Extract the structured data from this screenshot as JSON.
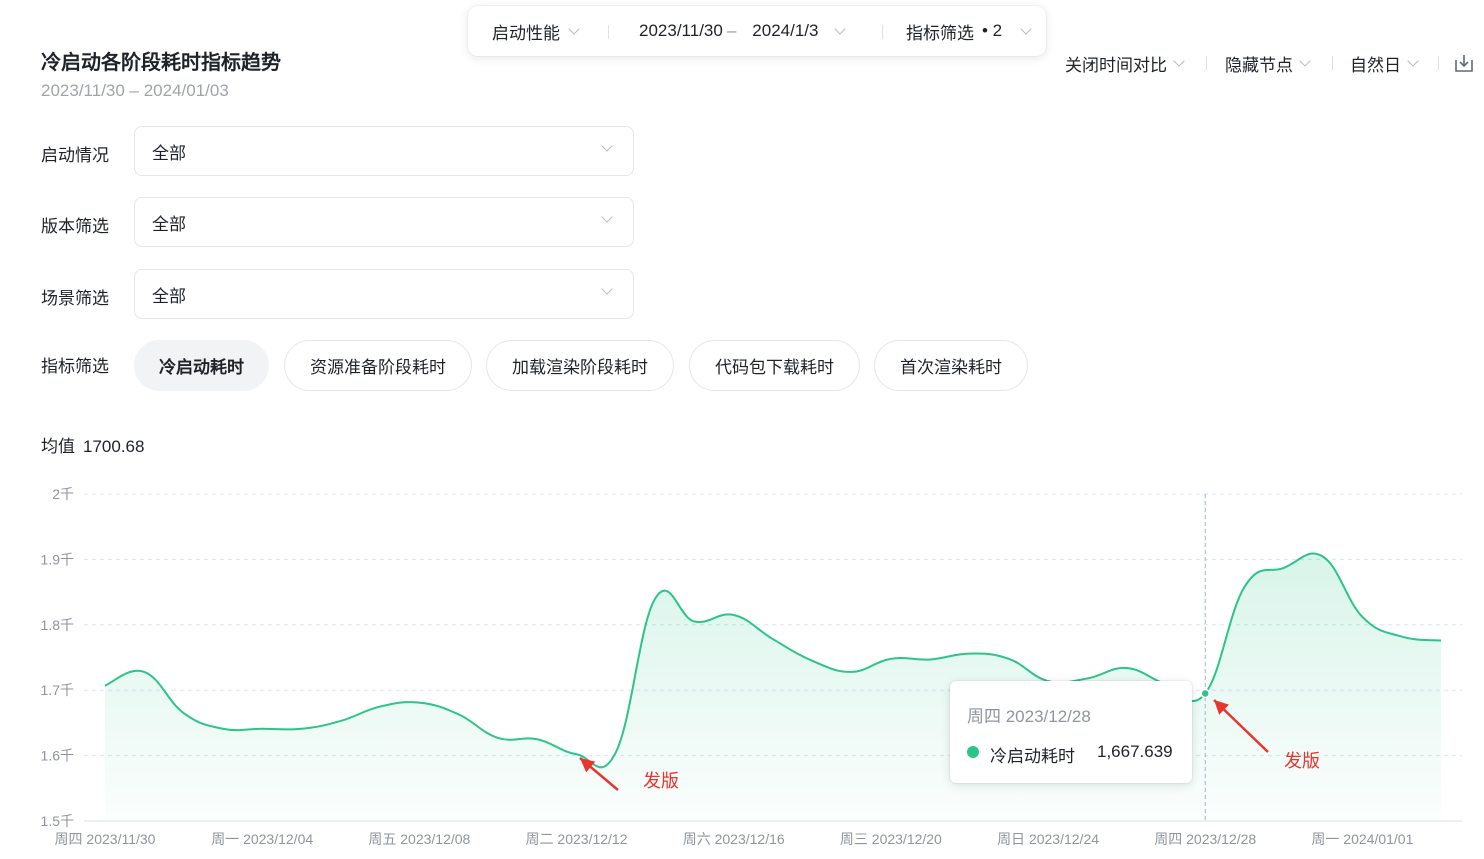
{
  "toolbar": {
    "category": "启动性能",
    "date_start": "2023/11/30",
    "date_sep": "–",
    "date_end": "2024/1/3",
    "metric_filter": "指标筛选",
    "metric_count_prefix": "• 2"
  },
  "card": {
    "title": "冷启动各阶段耗时指标趋势",
    "subtitle": "2023/11/30 – 2024/01/03"
  },
  "controls": {
    "compare": "关闭时间对比",
    "hide_nodes": "隐藏节点",
    "granularity": "自然日"
  },
  "filters": [
    {
      "label": "启动情况",
      "value": "全部"
    },
    {
      "label": "版本筛选",
      "value": "全部"
    },
    {
      "label": "场景筛选",
      "value": "全部"
    }
  ],
  "metric_filter": {
    "label": "指标筛选",
    "chips": [
      "冷启动耗时",
      "资源准备阶段耗时",
      "加载渲染阶段耗时",
      "代码包下载耗时",
      "首次渲染耗时"
    ],
    "active_index": 0
  },
  "average": {
    "label": "均值",
    "value": "1700.68"
  },
  "tooltip": {
    "date": "周四 2023/12/28",
    "series": "冷启动耗时",
    "value": "1,667.639"
  },
  "annotations": [
    "发版",
    "发版"
  ],
  "colors": {
    "series": "#2bc48a",
    "annotation": "#e8352e"
  },
  "chart_data": {
    "type": "area",
    "y_ticks": [
      "1.5千",
      "1.6千",
      "1.7千",
      "1.8千",
      "1.9千",
      "2千"
    ],
    "ylim": [
      1500,
      2000
    ],
    "x_tick_labels": [
      "周四 2023/11/30",
      "周一 2023/12/04",
      "周五 2023/12/08",
      "周二 2023/12/12",
      "周六 2023/12/16",
      "周三 2023/12/20",
      "周日 2023/12/24",
      "周四 2023/12/28",
      "周一 2024/01/01"
    ],
    "x": [
      "2023/11/30",
      "2023/12/01",
      "2023/12/02",
      "2023/12/03",
      "2023/12/04",
      "2023/12/05",
      "2023/12/06",
      "2023/12/07",
      "2023/12/08",
      "2023/12/09",
      "2023/12/10",
      "2023/12/11",
      "2023/12/12",
      "2023/12/13",
      "2023/12/14",
      "2023/12/15",
      "2023/12/16",
      "2023/12/17",
      "2023/12/18",
      "2023/12/19",
      "2023/12/20",
      "2023/12/21",
      "2023/12/22",
      "2023/12/23",
      "2023/12/24",
      "2023/12/25",
      "2023/12/26",
      "2023/12/27",
      "2023/12/28",
      "2023/12/29",
      "2023/12/30",
      "2023/12/31",
      "2024/01/01",
      "2024/01/02",
      "2024/01/03"
    ],
    "series": [
      {
        "name": "冷启动耗时",
        "values": [
          1707,
          1728,
          1665,
          1641,
          1641,
          1641,
          1653,
          1675,
          1681,
          1663,
          1627,
          1625,
          1602,
          1605,
          1840,
          1805,
          1815,
          1778,
          1745,
          1728,
          1748,
          1747,
          1756,
          1748,
          1714,
          1718,
          1734,
          1709,
          1695,
          1858,
          1887,
          1904,
          1812,
          1782,
          1776
        ]
      }
    ],
    "highlight_index": 28,
    "grid": true
  }
}
